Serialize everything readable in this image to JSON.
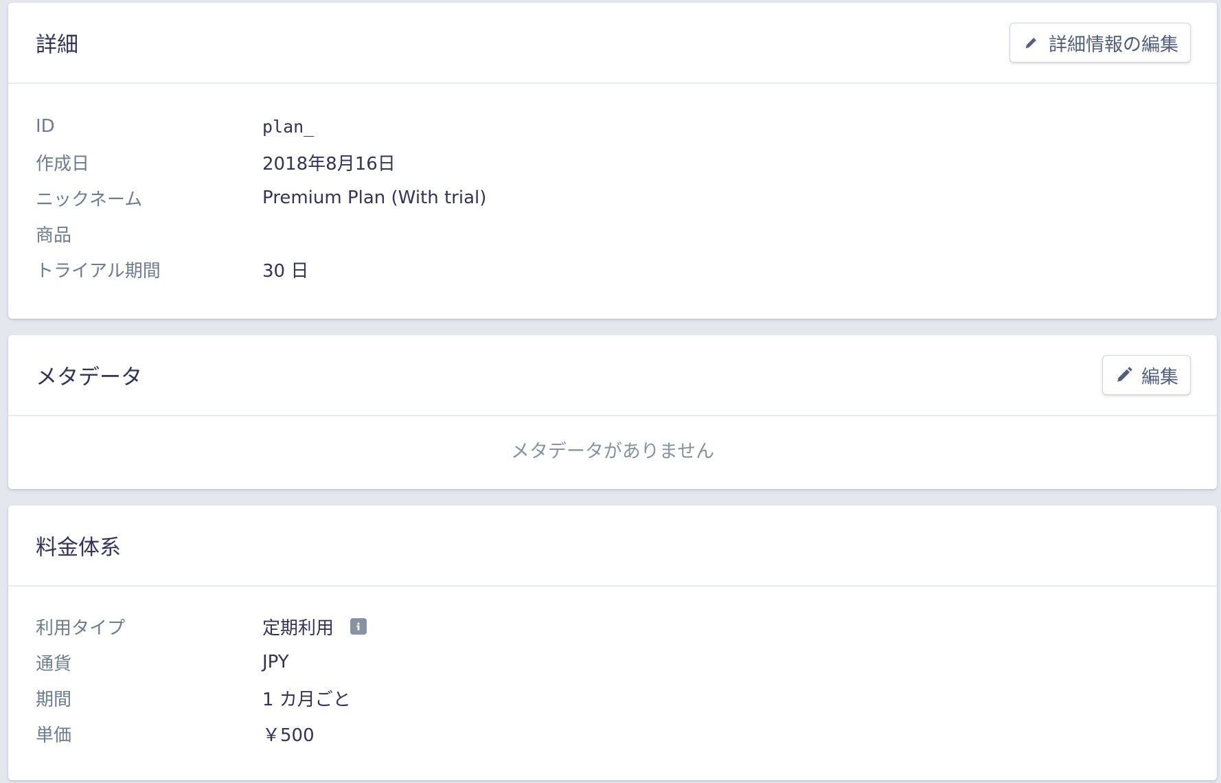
{
  "details": {
    "title": "詳細",
    "edit_button_label": "詳細情報の編集",
    "rows": [
      {
        "label": "ID",
        "value": "plan_"
      },
      {
        "label": "作成日",
        "value": "2018年8月16日"
      },
      {
        "label": "ニックネーム",
        "value": "Premium Plan (With trial)"
      },
      {
        "label": "商品",
        "value": ""
      },
      {
        "label": "トライアル期間",
        "value": "30 日"
      }
    ]
  },
  "metadata": {
    "title": "メタデータ",
    "edit_button_label": "編集",
    "empty_text": "メタデータがありません"
  },
  "pricing": {
    "title": "料金体系",
    "rows": [
      {
        "label": "利用タイプ",
        "value": "定期利用"
      },
      {
        "label": "通貨",
        "value": "JPY"
      },
      {
        "label": "期間",
        "value": "1 カ月ごと"
      },
      {
        "label": "単価",
        "value": "￥500"
      }
    ]
  },
  "icons": {
    "edit": "pencil-icon",
    "usage_info": "info-icon"
  },
  "colors": {
    "background": "#e4e8ee",
    "card": "#ffffff",
    "label": "#6b7c93",
    "value": "#32325d",
    "muted": "#8792a2"
  }
}
